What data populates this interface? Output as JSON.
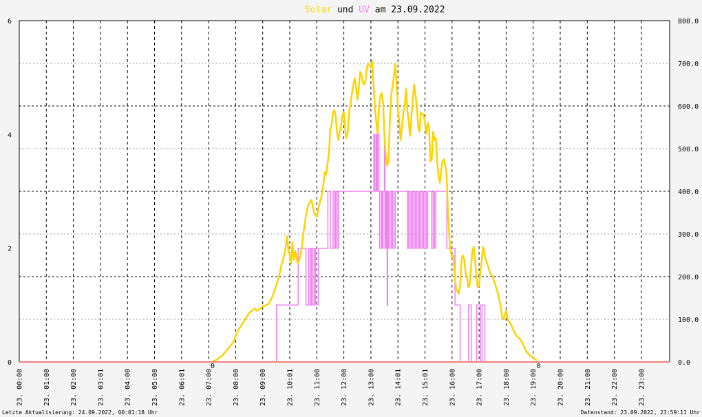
{
  "title": {
    "part1": "Solar",
    "part2": " und ",
    "part3": "UV",
    "part4": " am 23.09.2022"
  },
  "colors": {
    "solar": "#ffd200",
    "uv": "#ee82ee",
    "title_solar": "#ffd700",
    "title_uv": "#ee82ee",
    "baseline": "#f08080",
    "grid": "#000000"
  },
  "footer": {
    "left": "Letzte Aktualisierung: 24.09.2022, 00:01:18 Uhr",
    "right": "Datenstand: 23.09.2022, 23:59:11 Uhr"
  },
  "chart_data": {
    "type": "line",
    "title": "Solar und UV am 23.09.2022",
    "x_tick_labels": [
      "23. 00:00",
      "23. 01:00",
      "23. 02:00",
      "23. 03:01",
      "23. 04:00",
      "23. 05:00",
      "23. 06:01",
      "23. 07:00",
      "23. 08:00",
      "23. 09:00",
      "23. 10:01",
      "23. 11:00",
      "23. 12:00",
      "23. 13:00",
      "23. 14:01",
      "23. 15:01",
      "23. 16:00",
      "23. 17:00",
      "23. 18:00",
      "23. 19:00",
      "23. 20:00",
      "23. 21:00",
      "23. 22:00",
      "23. 23:00"
    ],
    "y_left": {
      "ticks": [
        "0",
        "2",
        "4",
        "6"
      ],
      "range": [
        0,
        6
      ]
    },
    "y_right": {
      "ticks": [
        "0.0",
        "100.0",
        "200.0",
        "300.0",
        "400.0",
        "500.0",
        "600.0",
        "700.0",
        "800.0"
      ],
      "range": [
        0,
        800
      ]
    },
    "zero_markers": [
      {
        "text": "0",
        "x_hours": 7.1
      },
      {
        "text": "0",
        "x_hours": 19.15
      }
    ],
    "series": [
      {
        "axis": "right",
        "x_hours": [
          7.1,
          7.3,
          7.5,
          7.7,
          7.9,
          8.0,
          8.1,
          8.3,
          8.5,
          8.7,
          8.8,
          9.0,
          9.2,
          9.3,
          9.4,
          9.5,
          9.6,
          9.7,
          9.8,
          9.85,
          9.9,
          9.95,
          10.0,
          10.05,
          10.1,
          10.15,
          10.2,
          10.3,
          10.4,
          10.45,
          10.5,
          10.55,
          10.6,
          10.65,
          10.7,
          10.8,
          10.9,
          11.0,
          11.1,
          11.2,
          11.25,
          11.3,
          11.35,
          11.4,
          11.45,
          11.5,
          11.55,
          11.6,
          11.65,
          11.7,
          11.75,
          11.8,
          11.85,
          11.9,
          11.95,
          12.0,
          12.05,
          12.1,
          12.15,
          12.2,
          12.25,
          12.3,
          12.35,
          12.4,
          12.45,
          12.5,
          12.55,
          12.6,
          12.65,
          12.7,
          12.75,
          12.8,
          12.85,
          12.9,
          12.95,
          13.0,
          13.05,
          13.1,
          13.15,
          13.2,
          13.25,
          13.3,
          13.35,
          13.4,
          13.45,
          13.5,
          13.55,
          13.6,
          13.65,
          13.7,
          13.75,
          13.8,
          13.85,
          13.9,
          13.95,
          14.0,
          14.05,
          14.1,
          14.15,
          14.2,
          14.25,
          14.3,
          14.35,
          14.4,
          14.45,
          14.5,
          14.55,
          14.6,
          14.65,
          14.7,
          14.75,
          14.8,
          14.85,
          14.9,
          14.95,
          15.0,
          15.05,
          15.1,
          15.15,
          15.2,
          15.25,
          15.3,
          15.35,
          15.4,
          15.45,
          15.5,
          15.55,
          15.6,
          15.65,
          15.7,
          15.75,
          15.8,
          15.85,
          15.9,
          15.95,
          16.0,
          16.05,
          16.1,
          16.15,
          16.2,
          16.25,
          16.3,
          16.35,
          16.4,
          16.45,
          16.5,
          16.55,
          16.6,
          16.65,
          16.7,
          16.75,
          16.8,
          16.85,
          16.9,
          16.95,
          17.0,
          17.05,
          17.1,
          17.15,
          17.2,
          17.25,
          17.3,
          17.4,
          17.5,
          17.6,
          17.7,
          17.8,
          17.85,
          17.9,
          17.95,
          18.0,
          18.05,
          18.1,
          18.2,
          18.3,
          18.4,
          18.5,
          18.6,
          18.7,
          18.8,
          18.9,
          19.0,
          19.1,
          19.15
        ],
        "values": [
          0,
          5,
          15,
          30,
          45,
          60,
          75,
          95,
          115,
          125,
          120,
          130,
          135,
          145,
          160,
          180,
          200,
          230,
          250,
          270,
          295,
          260,
          250,
          230,
          280,
          240,
          260,
          230,
          250,
          270,
          300,
          320,
          345,
          360,
          370,
          380,
          350,
          340,
          370,
          395,
          420,
          445,
          440,
          465,
          490,
          545,
          555,
          585,
          590,
          575,
          535,
          520,
          540,
          555,
          580,
          585,
          545,
          525,
          540,
          590,
          605,
          630,
          650,
          665,
          645,
          615,
          640,
          680,
          675,
          655,
          650,
          660,
          690,
          700,
          695,
          690,
          705,
          650,
          595,
          560,
          535,
          600,
          625,
          630,
          610,
          530,
          485,
          460,
          470,
          560,
          625,
          645,
          670,
          700,
          650,
          595,
          560,
          520,
          550,
          585,
          600,
          640,
          590,
          560,
          530,
          575,
          620,
          650,
          625,
          600,
          550,
          540,
          585,
          580,
          580,
          560,
          535,
          560,
          550,
          470,
          475,
          540,
          520,
          525,
          470,
          435,
          420,
          450,
          470,
          475,
          460,
          440,
          350,
          290,
          260,
          245,
          250,
          200,
          175,
          165,
          160,
          180,
          240,
          250,
          240,
          210,
          200,
          175,
          180,
          220,
          260,
          270,
          240,
          200,
          175,
          180,
          215,
          240,
          270,
          250,
          240,
          230,
          210,
          200,
          180,
          160,
          130,
          105,
          100,
          110,
          120,
          100,
          95,
          85,
          70,
          60,
          55,
          45,
          30,
          20,
          15,
          10,
          5,
          3,
          0
        ]
      },
      {
        "axis": "left",
        "x_hours": [
          9.5,
          9.51,
          10.3,
          10.31,
          10.5,
          10.6,
          10.7,
          10.75,
          10.8,
          10.85,
          10.9,
          10.95,
          11.05,
          11.06,
          11.4,
          11.41,
          11.5,
          11.6,
          11.65,
          11.7,
          11.75,
          11.8,
          11.9,
          11.91,
          13.1,
          13.11,
          13.15,
          13.2,
          13.22,
          13.25,
          13.3,
          13.32,
          13.38,
          13.42,
          13.45,
          13.5,
          13.52,
          13.55,
          13.58,
          13.6,
          13.62,
          13.65,
          13.7,
          13.75,
          13.8,
          13.85,
          13.9,
          13.95,
          14.0,
          14.05,
          14.15,
          14.16,
          14.3,
          14.35,
          14.4,
          14.45,
          14.5,
          14.55,
          14.6,
          14.65,
          14.7,
          14.75,
          14.8,
          14.85,
          14.9,
          14.95,
          15.0,
          15.05,
          15.1,
          15.15,
          15.2,
          15.25,
          15.3,
          15.35,
          15.4,
          15.41,
          15.8,
          15.81,
          16.0,
          16.1,
          16.11,
          16.2,
          16.3,
          16.31,
          16.6,
          16.61,
          16.7,
          16.71,
          16.9,
          16.91,
          17.0,
          17.05,
          17.1,
          17.11,
          17.2,
          17.21,
          19.3
        ],
        "values": [
          0,
          1,
          1,
          2,
          2,
          1,
          2,
          1,
          2,
          1,
          2,
          1,
          1,
          2,
          2,
          3,
          2,
          3,
          2,
          3,
          2,
          3,
          3,
          3,
          3,
          4,
          3,
          4,
          3,
          4,
          3,
          2,
          3,
          2,
          3,
          4,
          2,
          3,
          2,
          1,
          3,
          2,
          3,
          2,
          3,
          2,
          3,
          3,
          3,
          3,
          3,
          3,
          3,
          2,
          3,
          2,
          3,
          2,
          3,
          2,
          3,
          2,
          3,
          2,
          3,
          2,
          3,
          2,
          3,
          3,
          3,
          2,
          3,
          2,
          3,
          3,
          3,
          2,
          2,
          2,
          1,
          1,
          0,
          0,
          0,
          1,
          1,
          0,
          0,
          1,
          1,
          0,
          0,
          1,
          1,
          0,
          0,
          0
        ]
      }
    ]
  }
}
